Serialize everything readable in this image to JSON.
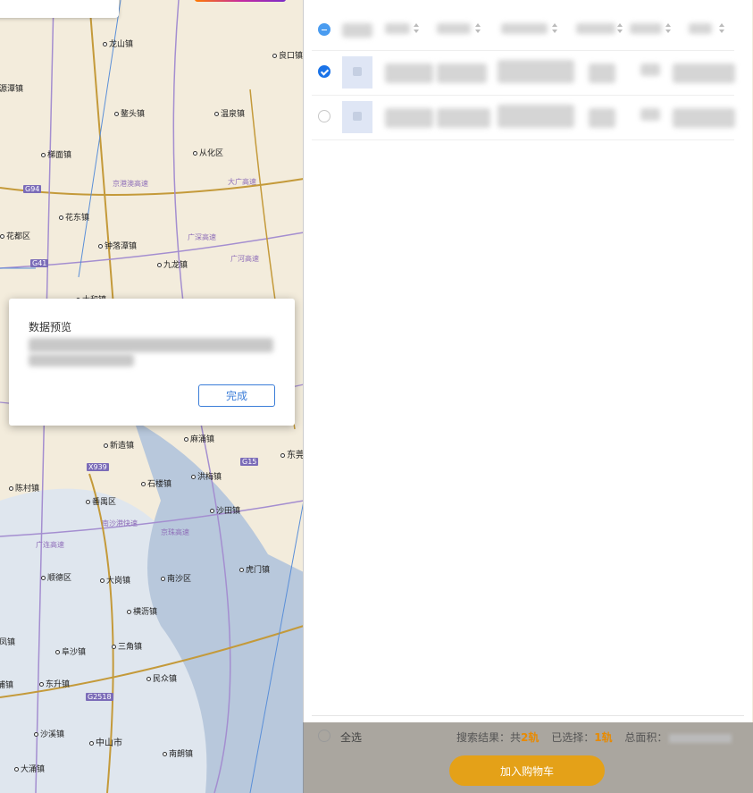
{
  "map": {
    "places": [
      {
        "name": "龙山镇"
      },
      {
        "name": "良口镇"
      },
      {
        "name": "源潭镇"
      },
      {
        "name": "鳌头镇"
      },
      {
        "name": "温泉镇"
      },
      {
        "name": "梯面镇"
      },
      {
        "name": "从化区"
      },
      {
        "name": "花东镇"
      },
      {
        "name": "花都区"
      },
      {
        "name": "钟落潭镇"
      },
      {
        "name": "九龙镇"
      },
      {
        "name": "太和镇"
      },
      {
        "name": "新造镇"
      },
      {
        "name": "麻涌镇"
      },
      {
        "name": "石楼镇"
      },
      {
        "name": "洪梅镇"
      },
      {
        "name": "陈村镇"
      },
      {
        "name": "番禺区"
      },
      {
        "name": "沙田镇"
      },
      {
        "name": "顺德区"
      },
      {
        "name": "大岗镇"
      },
      {
        "name": "南沙区"
      },
      {
        "name": "虎门镇"
      },
      {
        "name": "横沥镇"
      },
      {
        "name": "凤镇"
      },
      {
        "name": "三角镇"
      },
      {
        "name": "阜沙镇"
      },
      {
        "name": "民众镇"
      },
      {
        "name": "东升镇"
      },
      {
        "name": "沙溪镇"
      },
      {
        "name": "中山市"
      },
      {
        "name": "南朗镇"
      },
      {
        "name": "大涌镇"
      },
      {
        "name": "东莞"
      },
      {
        "name": "浦镇"
      }
    ],
    "highways": [
      "G94",
      "G41",
      "X939",
      "G15",
      "G2518"
    ],
    "roadnames": [
      "大广高速",
      "京港澳高速",
      "广河高速",
      "广连高速",
      "京珠高速",
      "南沙港快速",
      "广深高速"
    ]
  },
  "panel": {
    "rows": [
      {
        "state": "partial",
        "has_thumb": false
      },
      {
        "state": "checked",
        "has_thumb": true
      },
      {
        "state": "unchecked",
        "has_thumb": true
      }
    ]
  },
  "footer": {
    "select_all_label": "全选",
    "summary_prefix": "搜索结果：共",
    "result_count": "2轨",
    "selected_prefix": "已选择：",
    "selected_count": "1轨",
    "area_prefix": "总面积：",
    "add_cart_label": "加入购物车"
  },
  "modal": {
    "title": "数据预览",
    "done_label": "完成"
  },
  "colors": {
    "accent_blue": "#1a73e8",
    "orange": "#e4a118",
    "highlight": "#e88a00",
    "road_purple": "#8f6fb9"
  }
}
